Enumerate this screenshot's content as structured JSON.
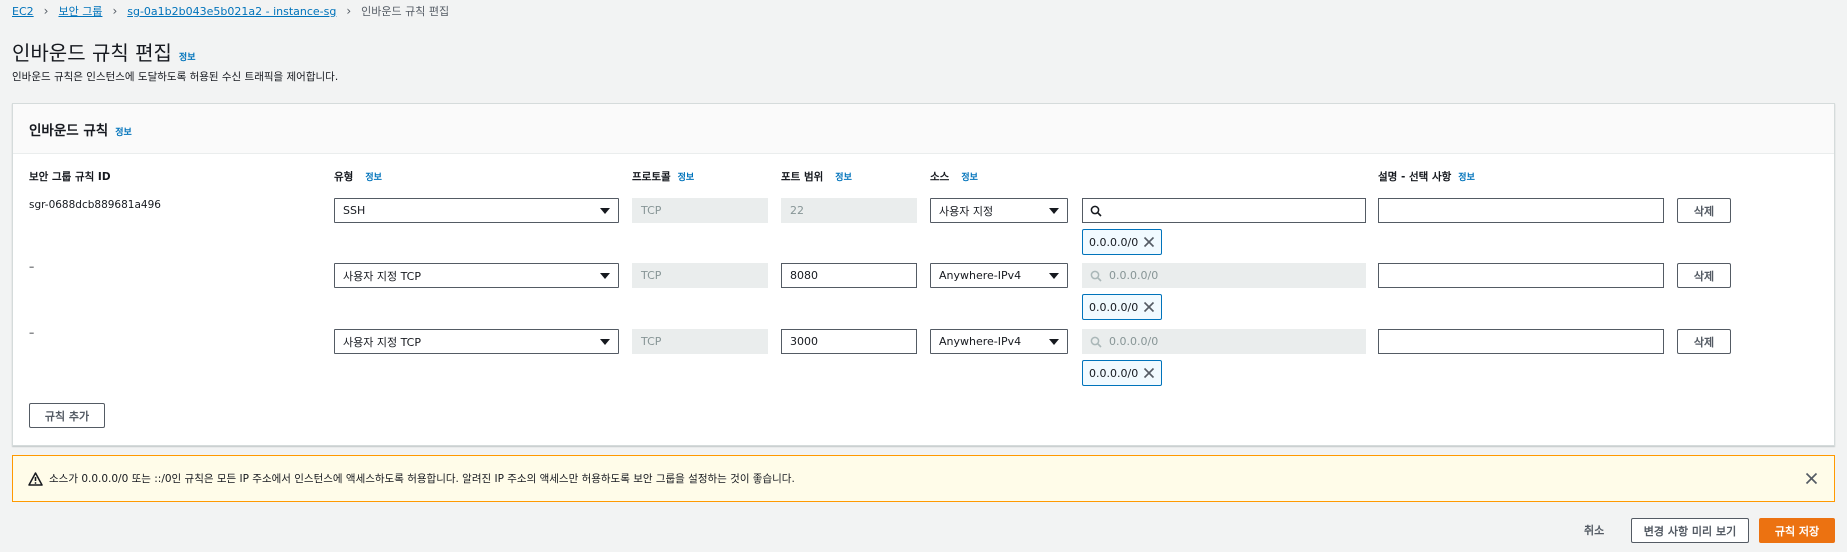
{
  "breadcrumb": {
    "items": [
      "EC2",
      "보안 그룹",
      "sg-0a1b2b043e5b021a2 - instance-sg"
    ],
    "current": "인바운드 규칙 편집"
  },
  "page": {
    "title": "인바운드 규칙 편집",
    "info": "정보",
    "subtitle": "인바운드 규칙은 인스턴스에 도달하도록 허용된 수신 트래픽을 제어합니다."
  },
  "panel": {
    "title": "인바운드 규칙",
    "info": "정보",
    "columns": {
      "rule_id": "보안 그룹 규칙 ID",
      "type": "유형",
      "protocol": "프로토콜",
      "port": "포트 범위",
      "source": "소스",
      "description": "설명 - 선택 사항",
      "info": "정보"
    },
    "rows": [
      {
        "rule_id": "sgr-0688dcb889681a496",
        "type": "SSH",
        "protocol": "TCP",
        "port": "22",
        "source": "사용자 지정",
        "search_value": "",
        "token": "0.0.0.0/0",
        "description": "",
        "delete": "삭제"
      },
      {
        "rule_id": "–",
        "type": "사용자 지정 TCP",
        "protocol": "TCP",
        "port": "8080",
        "source": "Anywhere-IPv4",
        "search_value": "0.0.0.0/0",
        "token": "0.0.0.0/0",
        "description": "",
        "delete": "삭제"
      },
      {
        "rule_id": "–",
        "type": "사용자 지정 TCP",
        "protocol": "TCP",
        "port": "3000",
        "source": "Anywhere-IPv4",
        "search_value": "0.0.0.0/0",
        "token": "0.0.0.0/0",
        "description": "",
        "delete": "삭제"
      }
    ],
    "add_rule": "규칙 추가"
  },
  "alert": {
    "text": "소스가 0.0.0.0/0 또는 ::/0인 규칙은 모든 IP 주소에서 인스턴스에 액세스하도록 허용합니다. 알려진 IP 주소의 액세스만 허용하도록 보안 그룹을 설정하는 것이 좋습니다."
  },
  "footer": {
    "cancel": "취소",
    "preview": "변경 사항 미리 보기",
    "save": "규칙 저장"
  },
  "colors": {
    "link": "#0073bb",
    "primary": "#ec7211",
    "warning_border": "#ff9900",
    "warning_bg": "#fffce9"
  },
  "icons": [
    "chevron-right-icon",
    "caret-down-icon",
    "search-icon",
    "close-icon",
    "warning-icon"
  ]
}
